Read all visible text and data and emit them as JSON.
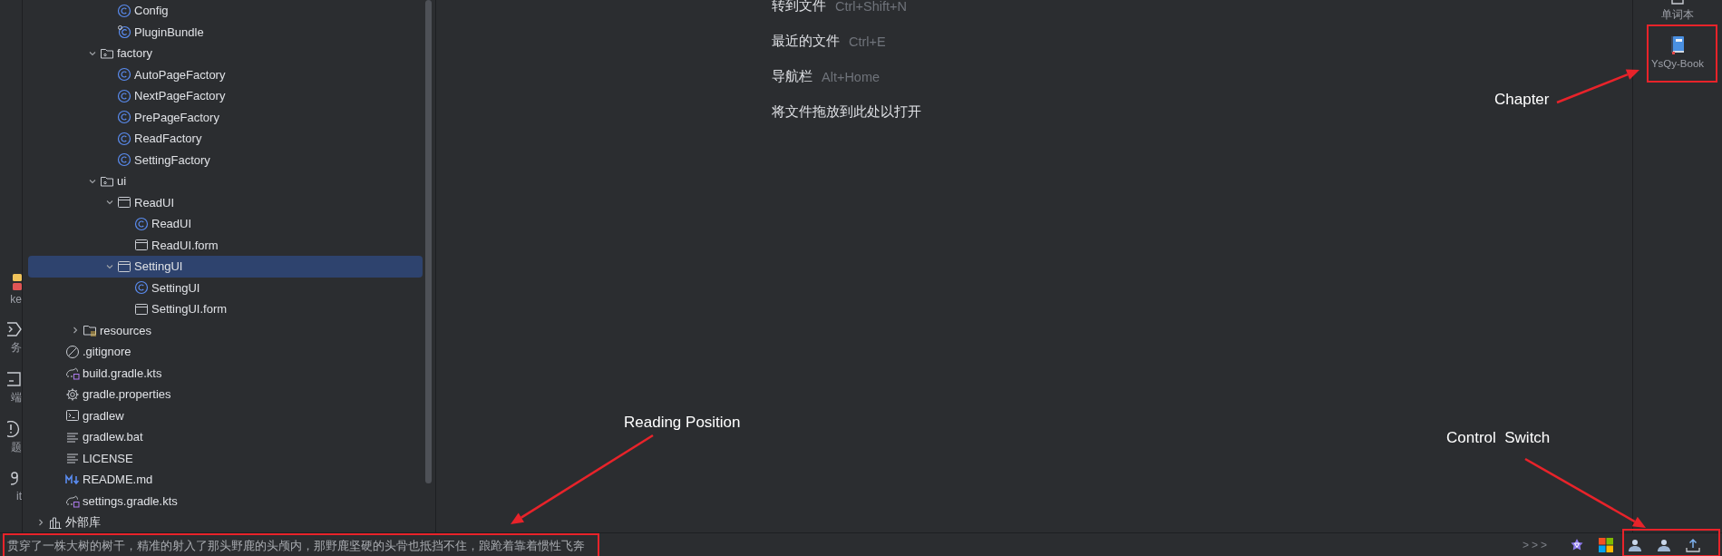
{
  "left_strip": [
    {
      "kind": "make",
      "label": "ke"
    },
    {
      "kind": "run",
      "label": "务"
    },
    {
      "kind": "terminal",
      "label": "端"
    },
    {
      "kind": "problems",
      "label": "题"
    },
    {
      "kind": "git",
      "label": "it"
    }
  ],
  "project_tree": [
    {
      "children": [
        {
          "children": [
            {
              "children": [
                {
                  "children": [
                    {
                      "label": "Config",
                      "kind": "class",
                      "selected": false
                    },
                    {
                      "label": "PluginBundle",
                      "kind": "bundle",
                      "selected": false
                    }
                  ]
                },
                {
                  "label": "factory",
                  "kind": "package",
                  "expanded": true,
                  "selected": false,
                  "children": [
                    {
                      "label": "AutoPageFactory",
                      "kind": "class",
                      "selected": false
                    },
                    {
                      "label": "NextPageFactory",
                      "kind": "class",
                      "selected": false
                    },
                    {
                      "label": "PrePageFactory",
                      "kind": "class",
                      "selected": false
                    },
                    {
                      "label": "ReadFactory",
                      "kind": "class",
                      "selected": false
                    },
                    {
                      "label": "SettingFactory",
                      "kind": "class",
                      "selected": false
                    }
                  ]
                },
                {
                  "label": "ui",
                  "kind": "package",
                  "expanded": true,
                  "selected": false,
                  "children": [
                    {
                      "label": "ReadUI",
                      "kind": "form",
                      "expanded": true,
                      "selected": false,
                      "children": [
                        {
                          "label": "ReadUI",
                          "kind": "class",
                          "selected": false
                        },
                        {
                          "label": "ReadUI.form",
                          "kind": "form",
                          "selected": false
                        }
                      ]
                    },
                    {
                      "label": "SettingUI",
                      "kind": "form",
                      "expanded": true,
                      "selected": true,
                      "children": [
                        {
                          "label": "SettingUI",
                          "kind": "class",
                          "selected": false
                        },
                        {
                          "label": "SettingUI.form",
                          "kind": "form",
                          "selected": false
                        }
                      ]
                    }
                  ]
                }
              ]
            },
            {
              "label": "resources",
              "kind": "resources",
              "expanded": false,
              "selected": false
            }
          ]
        },
        {
          "label": ".gitignore",
          "kind": "ignore",
          "selected": false
        },
        {
          "label": "build.gradle.kts",
          "kind": "gradle",
          "selected": false
        },
        {
          "label": "gradle.properties",
          "kind": "properties",
          "selected": false
        },
        {
          "label": "gradlew",
          "kind": "shell",
          "selected": false
        },
        {
          "label": "gradlew.bat",
          "kind": "text",
          "selected": false
        },
        {
          "label": "LICENSE",
          "kind": "text",
          "selected": false
        },
        {
          "label": "README.md",
          "kind": "markdown",
          "selected": false
        },
        {
          "label": "settings.gradle.kts",
          "kind": "gradle",
          "selected": false
        }
      ]
    },
    {
      "label": "外部库",
      "kind": "library",
      "expanded": false,
      "selected": false
    }
  ],
  "editor_hints": [
    {
      "action": "转到文件",
      "shortcut": "Ctrl+Shift+N"
    },
    {
      "action": "最近的文件",
      "shortcut": "Ctrl+E"
    },
    {
      "action": "导航栏",
      "shortcut": "Alt+Home"
    },
    {
      "action": "将文件拖放到此处以打开"
    }
  ],
  "right_strip": [
    {
      "kind": "notebook",
      "label": "单词本"
    },
    {
      "kind": "book",
      "label": "YsQy-Book"
    }
  ],
  "status_bar": {
    "reading_text": "贯穿了一株大树的树干，精准的射入了那头野鹿的头颅内，那野鹿坚硬的头骨也抵挡不住，踉跄着靠着惯性飞奔",
    "more": ">>>",
    "icons": [
      {
        "kind": "ai"
      },
      {
        "kind": "tiles"
      },
      {
        "kind": "person"
      },
      {
        "kind": "person"
      },
      {
        "kind": "upload"
      }
    ]
  },
  "annotations": [
    {
      "label": "Chapter"
    },
    {
      "label": "Reading Position"
    },
    {
      "label": "Control  Switch"
    }
  ]
}
